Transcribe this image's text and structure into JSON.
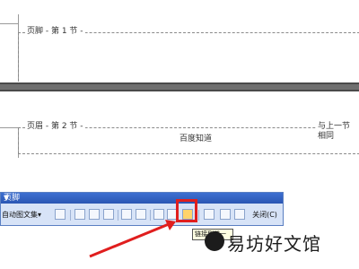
{
  "page1": {
    "footer_label": "页脚 - 第 1 节 -"
  },
  "page2": {
    "header_label": "页眉 - 第 2 节 -",
    "link_label": "与上一节相同",
    "header_text": "百度知道"
  },
  "toolbar": {
    "title": "页脚",
    "autotext_label": "自动图文集",
    "close_label": "关闭(C)"
  },
  "tooltip": {
    "text": "链接到前一"
  },
  "watermark": {
    "text": "易坊好文馆"
  },
  "colors": {
    "highlight": "#e01e1e",
    "toolbar_bg": "#d7e3f7",
    "toolbar_title": "#2a56b3"
  }
}
